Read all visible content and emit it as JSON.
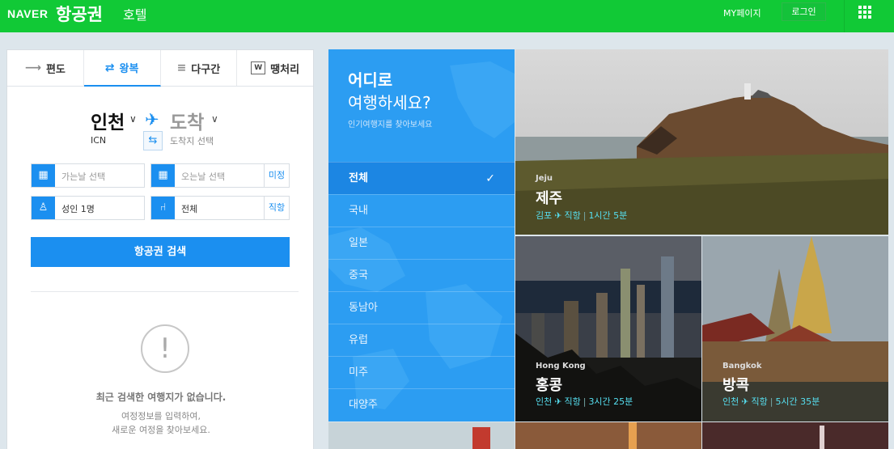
{
  "header": {
    "logo": "NAVER",
    "service": "항공권",
    "hotel": "호텔",
    "mypage": "MY페이지",
    "login": "로그인",
    "colors": {
      "brand": "#11c936"
    }
  },
  "tabs": [
    {
      "label": "편도",
      "icon": "arrow-right-icon"
    },
    {
      "label": "왕복",
      "icon": "round-trip-icon",
      "active": true
    },
    {
      "label": "다구간",
      "icon": "multi-leg-icon"
    },
    {
      "label": "땡처리",
      "icon": "w-badge-icon"
    }
  ],
  "route": {
    "departure": "인천",
    "departure_code": "ICN",
    "arrival": "도착",
    "arrival_select": "도착지 선택"
  },
  "fields": {
    "depart_date": "가는날 선택",
    "return_date": "오는날 선택",
    "return_undecided": "미정",
    "passengers": "성인 1명",
    "seat_class": "전체",
    "direct": "직항"
  },
  "search_button": "항공권 검색",
  "recent": {
    "title": "최근 검색한 여행지가 없습니다.",
    "line1": "여정정보를 입력하여,",
    "line2": "새로운 여정을 찾아보세요."
  },
  "destinations": {
    "title1": "어디로",
    "title2": "여행하세요?",
    "subtitle": "인기여행지를 찾아보세요",
    "items": [
      "전체",
      "국내",
      "일본",
      "중국",
      "동남아",
      "유럽",
      "미주",
      "대양주"
    ],
    "selected": 0,
    "colors": {
      "panel": "#2c9df2",
      "selected": "#1c86e3"
    }
  },
  "cards": [
    {
      "en": "Jeju",
      "ko": "제주",
      "from": "김포",
      "type": "직항",
      "duration": "1시간 5분"
    },
    {
      "en": "Hong Kong",
      "ko": "홍콩",
      "from": "인천",
      "type": "직항",
      "duration": "3시간 25분"
    },
    {
      "en": "Bangkok",
      "ko": "방콕",
      "from": "인천",
      "type": "직항",
      "duration": "5시간 35분"
    }
  ]
}
